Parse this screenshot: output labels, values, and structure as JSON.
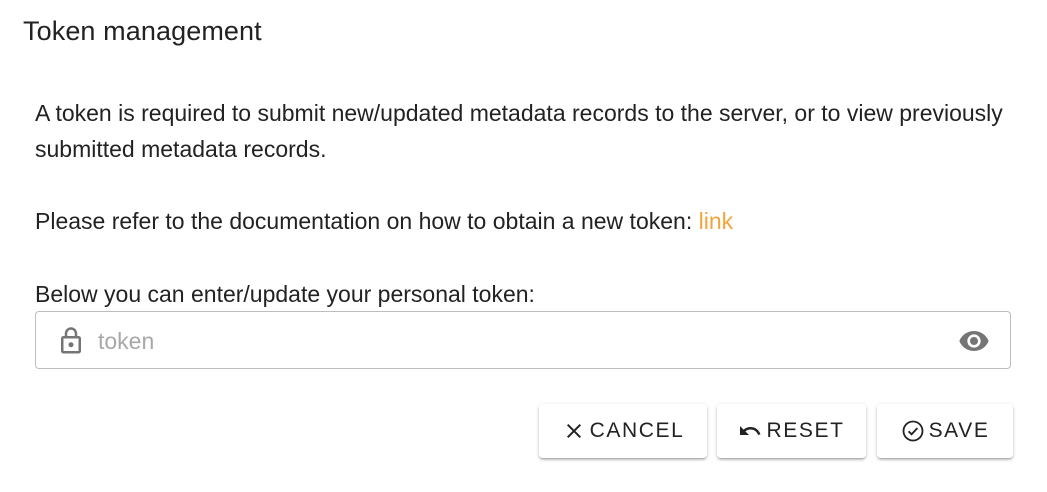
{
  "dialog": {
    "title": "Token management",
    "paragraph1": "A token is required to submit new/updated metadata records to the server, or to view previously submitted metadata records.",
    "paragraph2_prefix": "Please refer to the documentation on how to obtain a new token: ",
    "paragraph2_link": "link",
    "field_label": "Below you can enter/update your personal token:",
    "token_field": {
      "placeholder": "token",
      "value": "",
      "leading_icon": "lock-icon",
      "trailing_icon": "eye-icon"
    },
    "buttons": {
      "cancel": {
        "label": "CANCEL",
        "icon": "close-icon"
      },
      "reset": {
        "label": "RESET",
        "icon": "undo-icon"
      },
      "save": {
        "label": "SAVE",
        "icon": "check-circle-icon"
      }
    },
    "colors": {
      "link": "#f5a33b",
      "text": "#222222",
      "placeholder": "#a8a8a8",
      "border": "#bdbdbd"
    }
  }
}
